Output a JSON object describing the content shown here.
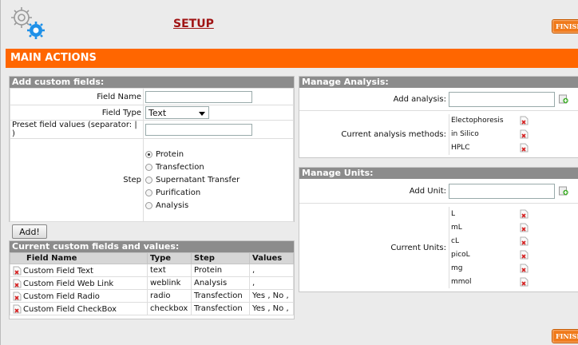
{
  "header": {
    "title": "SETUP",
    "finish_label": "FINISH"
  },
  "main_bar": {
    "title": "MAIN ACTIONS"
  },
  "custom_fields": {
    "heading": "Add custom fields:",
    "field_name_label": "Field Name",
    "field_name_value": "",
    "field_type_label": "Field Type",
    "field_type_value": "Text",
    "preset_label": "Preset field values (separator: | )",
    "preset_value": "",
    "step_label": "Step",
    "steps": [
      {
        "label": "Protein",
        "checked": true
      },
      {
        "label": "Transfection",
        "checked": false
      },
      {
        "label": "Supernatant Transfer",
        "checked": false
      },
      {
        "label": "Purification",
        "checked": false
      },
      {
        "label": "Analysis",
        "checked": false
      }
    ],
    "add_label": "Add!"
  },
  "current_fields": {
    "heading": "Current custom fields and values:",
    "columns": [
      "Field Name",
      "Type",
      "Step",
      "Values"
    ],
    "rows": [
      {
        "name": "Custom Field Text",
        "type": "text",
        "step": "Protein",
        "values": ","
      },
      {
        "name": "Custom Field Web Link",
        "type": "weblink",
        "step": "Analysis",
        "values": ","
      },
      {
        "name": "Custom Field Radio",
        "type": "radio",
        "step": "Transfection",
        "values": "Yes , No ,"
      },
      {
        "name": "Custom Field CheckBox",
        "type": "checkbox",
        "step": "Transfection",
        "values": "Yes , No ,"
      }
    ]
  },
  "analysis": {
    "heading": "Manage Analysis:",
    "add_label": "Add analysis:",
    "add_value": "",
    "current_label": "Current analysis methods:",
    "methods": [
      "Electophoresis",
      "in Silico",
      "HPLC"
    ]
  },
  "units": {
    "heading": "Manage Units:",
    "add_label": "Add Unit:",
    "add_value": "",
    "current_label": "Current Units:",
    "items": [
      "L",
      "mL",
      "cL",
      "picoL",
      "mg",
      "mmol"
    ]
  },
  "colors": {
    "accent": "#ff6600",
    "title": "#a01414",
    "panel_header": "#8c8c8c"
  }
}
